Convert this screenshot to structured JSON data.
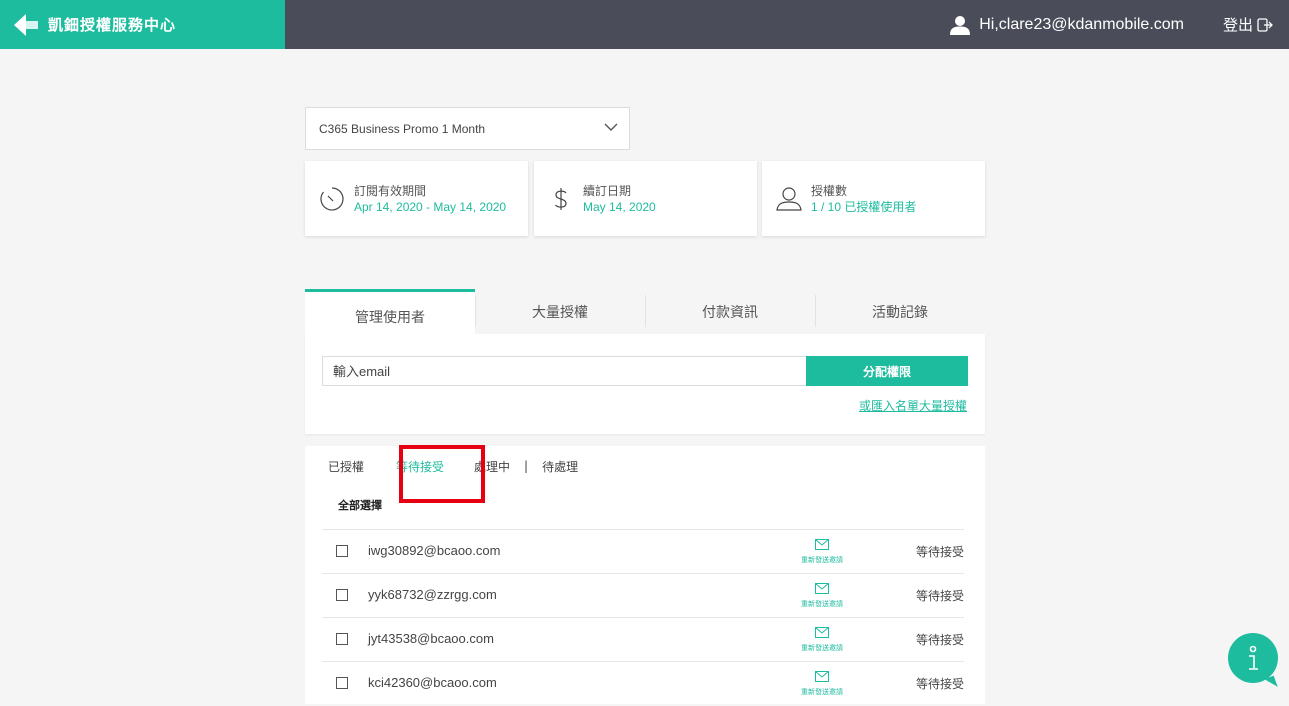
{
  "header": {
    "brand_title": "凱鈿授權服務中心",
    "user_label": "Hi,clare23@kdanmobile.com",
    "logout_label": "登出",
    "colors": {
      "brand": "#1ebc9e",
      "bar": "#4a4d59"
    }
  },
  "plan": {
    "selected": "C365 Business Promo 1 Month"
  },
  "cards": [
    {
      "icon": "timer-icon",
      "label": "訂閱有效期間",
      "value": "Apr 14, 2020 - May 14, 2020"
    },
    {
      "icon": "dollar-icon",
      "label": "續訂日期",
      "value": "May 14, 2020"
    },
    {
      "icon": "user-outline-icon",
      "label": "授權數",
      "value": "1 / 10 已授權使用者"
    }
  ],
  "tabs": [
    {
      "label": "管理使用者",
      "active": true
    },
    {
      "label": "大量授權",
      "active": false
    },
    {
      "label": "付款資訊",
      "active": false
    },
    {
      "label": "活動記錄",
      "active": false
    }
  ],
  "assign": {
    "email_placeholder": "輸入email",
    "button_label": "分配權限",
    "import_link": "或匯入名單大量授權"
  },
  "subtabs": {
    "authorized": "已授權",
    "pending": "等待接受",
    "processing": "處理中",
    "separator": "|",
    "todo": "待處理"
  },
  "list": {
    "select_all": "全部選擇",
    "rows": [
      {
        "email": "iwg30892@bcaoo.com",
        "resend": "重新發送邀請",
        "status": "等待接受"
      },
      {
        "email": "yyk68732@zzrgg.com",
        "resend": "重新發送邀請",
        "status": "等待接受"
      },
      {
        "email": "jyt43538@bcaoo.com",
        "resend": "重新發送邀請",
        "status": "等待接受"
      },
      {
        "email": "kci42360@bcaoo.com",
        "resend": "重新發送邀請",
        "status": "等待接受"
      }
    ]
  }
}
